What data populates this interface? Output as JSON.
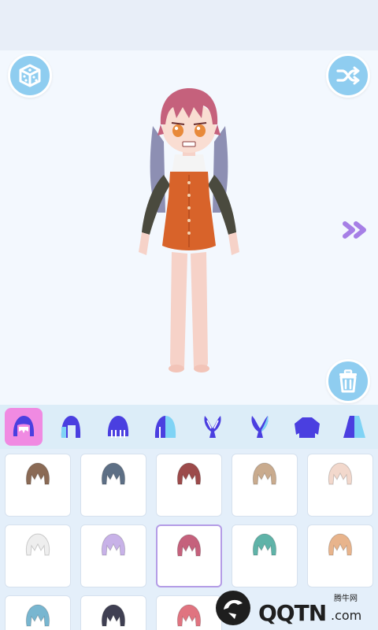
{
  "top_buttons": {
    "left_icon": "dice-cube-icon",
    "right_icon": "shuffle-icon"
  },
  "side_controls": {
    "next_icon": "double-chevron-right-icon",
    "delete_icon": "trash-icon"
  },
  "colors": {
    "button_blue": "#8fcdf0",
    "tab_active": "#f08ae2",
    "tab_icon_blue": "#4a3fe0",
    "tab_icon_light": "#7fd3f5",
    "next_arrow": "#a67fe6",
    "selected_border": "#b49ce6"
  },
  "category_tabs": [
    {
      "icon": "hair-front-icon",
      "active": true
    },
    {
      "icon": "hair-side-icon",
      "active": false
    },
    {
      "icon": "hair-back-icon",
      "active": false
    },
    {
      "icon": "hair-color-icon",
      "active": false
    },
    {
      "icon": "bunny-ears-icon",
      "active": false
    },
    {
      "icon": "bunny-ears-alt-icon",
      "active": false
    },
    {
      "icon": "sweater-icon",
      "active": false
    },
    {
      "icon": "dress-icon",
      "active": false
    }
  ],
  "hair_items": [
    {
      "color": "#8a6a55",
      "selected": false
    },
    {
      "color": "#5d6f85",
      "selected": false
    },
    {
      "color": "#9c4a4a",
      "selected": false
    },
    {
      "color": "#c9ab8e",
      "selected": false
    },
    {
      "color": "#f2d8cc",
      "selected": false
    },
    {
      "color": "#eeeeee",
      "selected": false
    },
    {
      "color": "#c8b2e8",
      "selected": false
    },
    {
      "color": "#c5617c",
      "selected": true
    },
    {
      "color": "#5fb3a8",
      "selected": false
    },
    {
      "color": "#e8b48c",
      "selected": false
    },
    {
      "color": "#78b6d0",
      "selected": false
    },
    {
      "color": "#3f3f52",
      "selected": false
    },
    {
      "color": "#e07480",
      "selected": false
    }
  ],
  "watermark": {
    "brand": "QQTN",
    "suffix": ".com",
    "cn": "腾牛网"
  }
}
